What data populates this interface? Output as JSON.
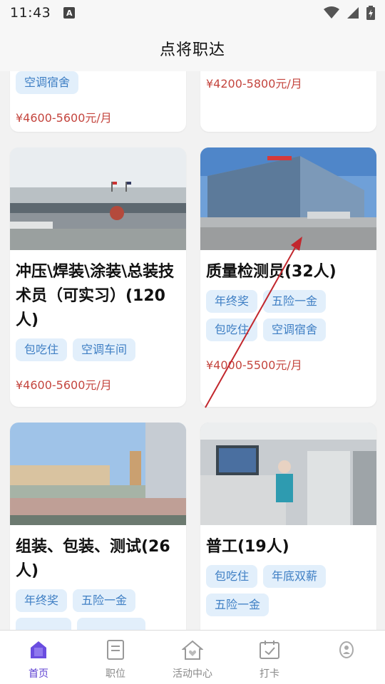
{
  "status": {
    "time": "11:43",
    "a_badge": "A"
  },
  "header": {
    "title": "点将职达"
  },
  "cards": [
    {
      "title": "",
      "tags": [
        "空调宿舍"
      ],
      "salary": "¥4600-5600元/月"
    },
    {
      "title": "",
      "tags": [],
      "salary": "¥4200-5800元/月"
    },
    {
      "title": "冲压\\焊装\\涂装\\总装技术员（可实习）(120人)",
      "tags": [
        "包吃住",
        "空调车间"
      ],
      "salary": "¥4600-5600元/月"
    },
    {
      "title": "质量检测员(32人)",
      "tags": [
        "年终奖",
        "五险一金",
        "包吃住",
        "空调宿舍"
      ],
      "salary": "¥4000-5500元/月"
    },
    {
      "title": "组装、包装、测试(26人)",
      "tags": [
        "年终奖",
        "五险一金",
        "",
        ""
      ],
      "salary": ""
    },
    {
      "title": "普工(19人)",
      "tags": [
        "包吃住",
        "年底双薪",
        "五险一金"
      ],
      "salary": ""
    }
  ],
  "tabbar": {
    "home": "首页",
    "jobs": "职位",
    "activity": "活动中心",
    "checkin": "打卡",
    "mine": ""
  },
  "colors": {
    "accent": "#5c3fd1",
    "tag_bg": "#e2effb",
    "tag_text": "#3f7fc4",
    "salary": "#c4453e",
    "arrow": "#c2272d"
  }
}
